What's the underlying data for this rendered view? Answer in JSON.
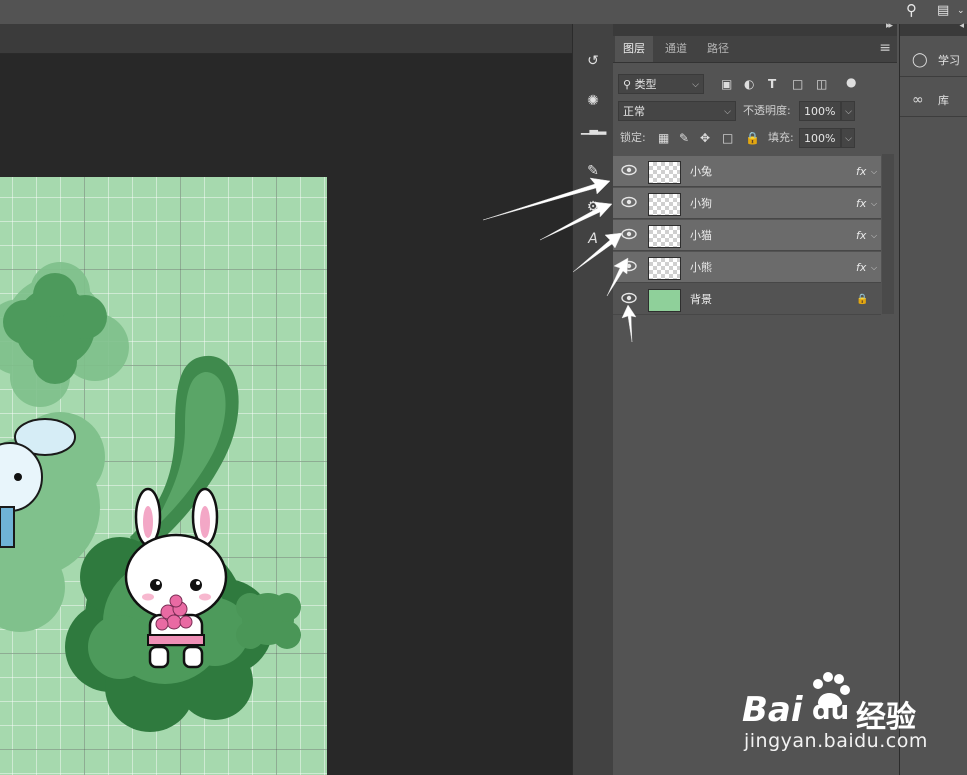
{
  "panel_tabs": [
    "图层",
    "通道",
    "路径"
  ],
  "filter": {
    "kind": "类型"
  },
  "blend": {
    "mode": "正常",
    "opacity_label": "不透明度:",
    "opacity_value": "100%"
  },
  "lock": {
    "label": "锁定:",
    "fill_label": "填充:",
    "fill_value": "100%"
  },
  "layers": [
    {
      "name": "小兔",
      "fx": "fx"
    },
    {
      "name": "小狗",
      "fx": "fx"
    },
    {
      "name": "小猫",
      "fx": "fx"
    },
    {
      "name": "小熊",
      "fx": "fx"
    },
    {
      "name": "背景"
    }
  ],
  "right_panel": [
    {
      "label": "学习",
      "icon": "lightbulb-icon"
    },
    {
      "label": "库",
      "icon": "creative-cloud-icon"
    }
  ],
  "watermark": {
    "brand_left": "Bai",
    "brand_right": "du",
    "brand_cn": "经验",
    "url": "jingyan.baidu.com"
  },
  "colors": {
    "accent_bg": "#535353",
    "layer_highlight": "#6b6b6b",
    "canvas_green": "#a6d9ae"
  }
}
